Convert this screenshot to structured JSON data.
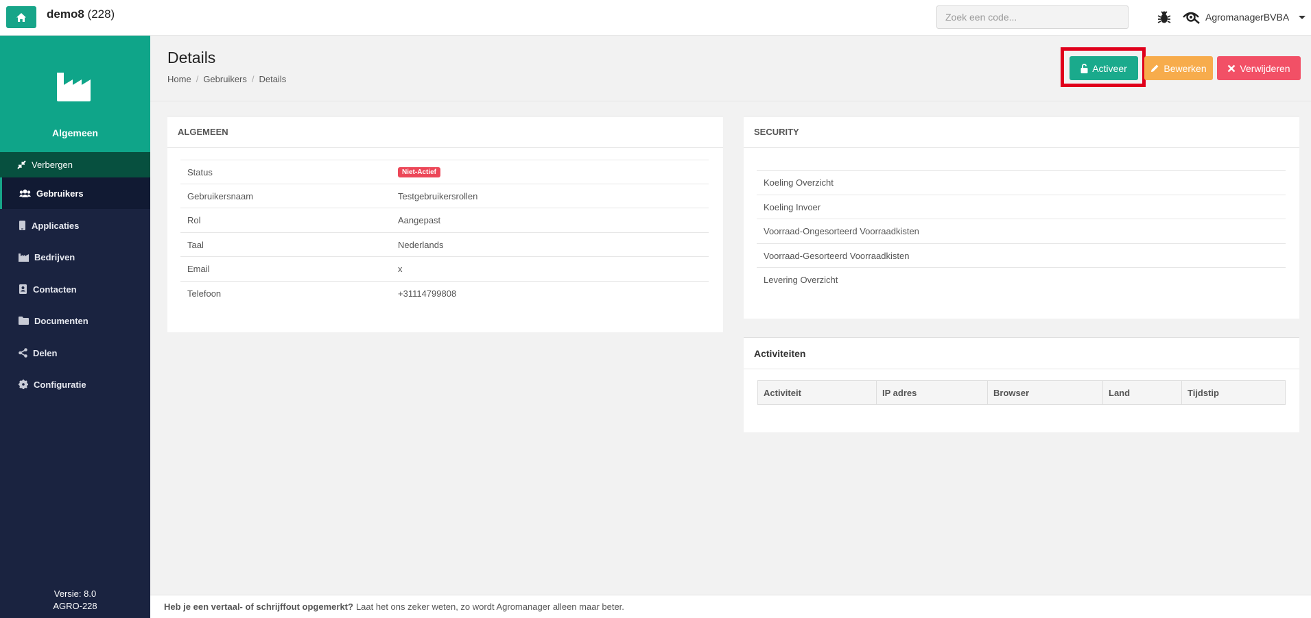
{
  "header": {
    "app_name": "demo8",
    "app_count": "(228)",
    "search_placeholder": "Zoek een code...",
    "user_name": "AgromanagerBVBA"
  },
  "sidebar": {
    "section_label": "Algemeen",
    "hide_label": "Verbergen",
    "items": [
      {
        "label": "Gebruikers",
        "icon": "users-icon",
        "active": true
      },
      {
        "label": "Applicaties",
        "icon": "mobile-icon"
      },
      {
        "label": "Bedrijven",
        "icon": "factory-icon"
      },
      {
        "label": "Contacten",
        "icon": "address-book-icon"
      },
      {
        "label": "Documenten",
        "icon": "folder-icon"
      },
      {
        "label": "Delen",
        "icon": "share-icon"
      },
      {
        "label": "Configuratie",
        "icon": "gear-icon"
      }
    ],
    "version_line": "Versie: 8.0",
    "build_line": "AGRO-228"
  },
  "page": {
    "title": "Details",
    "breadcrumb": [
      "Home",
      "Gebruikers",
      "Details"
    ],
    "buttons": {
      "activate": "Activeer",
      "edit": "Bewerken",
      "delete": "Verwijderen"
    }
  },
  "general": {
    "title": "ALGEMEEN",
    "rows": [
      {
        "label": "Status",
        "value": "Niet-Actief"
      },
      {
        "label": "Gebruikersnaam",
        "value": "Testgebruikersrollen"
      },
      {
        "label": "Rol",
        "value": "Aangepast"
      },
      {
        "label": "Taal",
        "value": "Nederlands"
      },
      {
        "label": "Email",
        "value": "x"
      },
      {
        "label": "Telefoon",
        "value": "+31114799808"
      }
    ]
  },
  "security": {
    "title": "SECURITY",
    "items": [
      "Koeling Overzicht",
      "Koeling Invoer",
      "Voorraad-Ongesorteerd Voorraadkisten",
      "Voorraad-Gesorteerd Voorraadkisten",
      "Levering Overzicht"
    ]
  },
  "activities": {
    "title": "Activiteiten",
    "columns": [
      "Activiteit",
      "IP adres",
      "Browser",
      "Land",
      "Tijdstip"
    ]
  },
  "footer": {
    "bold": "Heb je een vertaal- of schrijffout opgemerkt?",
    "text": "Laat het ons zeker weten, zo wordt Agromanager alleen maar beter."
  },
  "colors": {
    "brand": "#17a589",
    "sidebar": "#1a2340",
    "danger": "#f25066",
    "warning": "#f7ac4c"
  }
}
